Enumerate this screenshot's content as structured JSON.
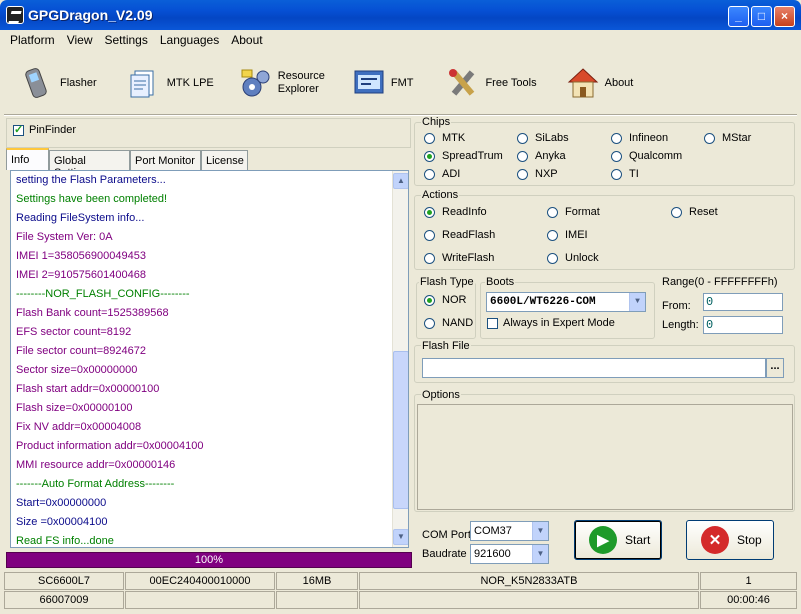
{
  "app": {
    "title": "GPGDragon_V2.09"
  },
  "menu": [
    "Platform",
    "View",
    "Settings",
    "Languages",
    "About"
  ],
  "toolbar": [
    {
      "label": "Flasher",
      "icon": "phone-icon"
    },
    {
      "label": "MTK LPE",
      "icon": "document-icon"
    },
    {
      "label": "Resource\nExplorer",
      "icon": "resource-explorer-icon"
    },
    {
      "label": "FMT",
      "icon": "fmt-icon"
    },
    {
      "label": "Free Tools",
      "icon": "tools-icon"
    },
    {
      "label": "About",
      "icon": "house-icon"
    }
  ],
  "pinfinder": {
    "label": "PinFinder",
    "checked": true
  },
  "tabs": [
    "Info",
    "Global Settings",
    "Port Monitor",
    "License"
  ],
  "log": [
    {
      "text": "setting the Flash Parameters...",
      "color": "navy"
    },
    {
      "text": "Settings have been completed!",
      "color": "green"
    },
    {
      "text": "Reading FileSystem info...",
      "color": "navy"
    },
    {
      "text": "File System Ver: 0A",
      "color": "purple"
    },
    {
      "text": "IMEI 1=358056900049453",
      "color": "purple"
    },
    {
      "text": "IMEI 2=910575601400468",
      "color": "purple"
    },
    {
      "text": "--------NOR_FLASH_CONFIG--------",
      "color": "green"
    },
    {
      "text": "Flash Bank count=1525389568",
      "color": "purple"
    },
    {
      "text": "EFS sector count=8192",
      "color": "purple"
    },
    {
      "text": "File sector count=8924672",
      "color": "purple"
    },
    {
      "text": "Sector size=0x00000000",
      "color": "purple"
    },
    {
      "text": "Flash start addr=0x00000100",
      "color": "purple"
    },
    {
      "text": "Flash size=0x00000100",
      "color": "purple"
    },
    {
      "text": "Fix NV addr=0x00004008",
      "color": "purple"
    },
    {
      "text": "Product information addr=0x00004100",
      "color": "purple"
    },
    {
      "text": "MMI resource addr=0x00000146",
      "color": "purple"
    },
    {
      "text": "-------Auto Format Address--------",
      "color": "green"
    },
    {
      "text": "Start=0x00000000",
      "color": "navy"
    },
    {
      "text": "Size =0x00004100",
      "color": "navy"
    },
    {
      "text": "Read FS info...done",
      "color": "green"
    }
  ],
  "progress": {
    "label": "100%",
    "value": 1.0
  },
  "chips": {
    "title": "Chips",
    "options": [
      "MTK",
      "SiLabs",
      "Infineon",
      "MStar",
      "SpreadTrum",
      "Anyka",
      "Qualcomm",
      "ADI",
      "NXP",
      "TI"
    ],
    "selected": "SpreadTrum"
  },
  "actions": {
    "title": "Actions",
    "options": [
      "ReadInfo",
      "Format",
      "Reset",
      "ReadFlash",
      "IMEI",
      "WriteFlash",
      "Unlock"
    ],
    "selected": "ReadInfo"
  },
  "flash_type": {
    "title": "Flash Type",
    "options": [
      "NOR",
      "NAND"
    ],
    "selected": "NOR"
  },
  "boots": {
    "title": "Boots",
    "value": "6600L/WT6226-COM",
    "expert_label": "Always in Expert Mode",
    "expert_checked": false
  },
  "range": {
    "title": "Range(0 - FFFFFFFFh)",
    "from_label": "From:",
    "from_value": "0",
    "length_label": "Length:",
    "length_value": "0"
  },
  "flash_file": {
    "title": "Flash File",
    "value": "",
    "browse": "..."
  },
  "options_group": {
    "title": "Options"
  },
  "com": {
    "port_label": "COM Port",
    "port_value": "COM37",
    "baud_label": "Baudrate",
    "baud_value": "921600"
  },
  "buttons": {
    "start": "Start",
    "stop": "Stop"
  },
  "statusbar": [
    "SC6600L7",
    "00EC240400010000",
    "16MB",
    "NOR_K5N2833ATB",
    "1",
    "66007009",
    "",
    "",
    "",
    "00:00:46"
  ],
  "colors": {
    "navy": "#0a0a8a",
    "green": "#008000",
    "purple": "#800080",
    "progress": "#800080"
  }
}
